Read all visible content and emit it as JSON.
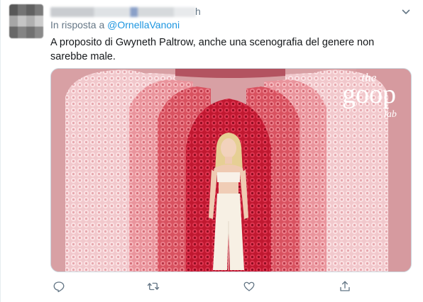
{
  "author": {
    "handle_suffix": "h"
  },
  "reply": {
    "prefix": "In risposta a",
    "mention": "@OrnellaVanoni"
  },
  "tweet": {
    "text": "A proposito di Gwyneth Paltrow, anche una scenografia del genere non sarebbe male."
  },
  "media": {
    "logo_line1": "the",
    "logo_line2": "goop",
    "logo_line3": "lab"
  },
  "actions": [
    {
      "name": "reply",
      "icon": "speech-bubble-icon"
    },
    {
      "name": "retweet",
      "icon": "retweet-icon"
    },
    {
      "name": "like",
      "icon": "heart-icon"
    },
    {
      "name": "share",
      "icon": "share-upload-icon"
    }
  ],
  "colors": {
    "link": "#1b95e0",
    "secondary_text": "#657786",
    "icon": "#657786"
  }
}
